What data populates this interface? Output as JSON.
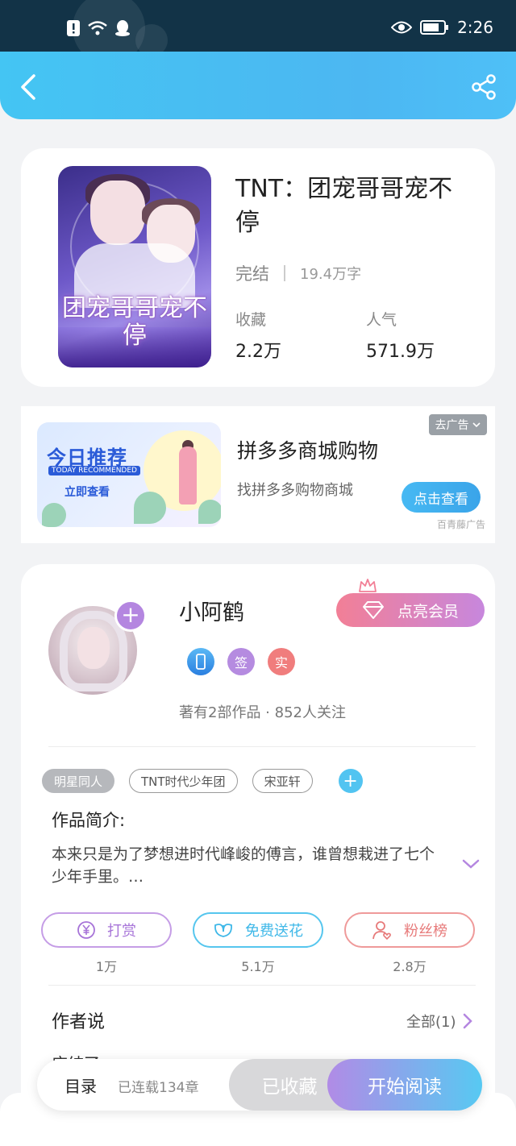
{
  "status_bar": {
    "time": "2:26"
  },
  "book": {
    "title": "TNT：团宠哥哥宠不停",
    "status": "完结",
    "word_count": "19.4万字",
    "favorites_label": "收藏",
    "favorites_value": "2.2万",
    "popularity_label": "人气",
    "popularity_value": "571.9万",
    "cover_title": "团宠哥哥宠不停"
  },
  "ad": {
    "title": "拼多多商城购物",
    "subtitle": "找拼多多购物商城",
    "tag": "去广告",
    "button": "点击查看",
    "source": "百青藤广告",
    "image_headline": "今日推荐",
    "image_en": "TODAY RECOMMENDED",
    "image_cta": "立即查看"
  },
  "author": {
    "name": "小阿鹤",
    "vip_label": "点亮会员",
    "badge_sign": "签",
    "badge_real": "实",
    "meta": "著有2部作品 · 852人关注"
  },
  "tags": [
    "明星同人",
    "TNT时代少年团",
    "宋亚轩"
  ],
  "intro": {
    "title": "作品简介:",
    "text": "本来只是为了梦想进时代峰峻的傅言，谁曾想栽进了七个少年手里。…"
  },
  "actions": [
    {
      "label": "打赏",
      "count": "1万",
      "icon": "yen-icon"
    },
    {
      "label": "免费送花",
      "count": "5.1万",
      "icon": "flower-icon"
    },
    {
      "label": "粉丝榜",
      "count": "2.8万",
      "icon": "user-heart-icon"
    }
  ],
  "author_says": {
    "title": "作者说",
    "all_label": "全部(1)",
    "peek": "应结了"
  },
  "bottom": {
    "toc": "目录",
    "chapters": "已连载134章",
    "collected": "已收藏",
    "read": "开始阅读"
  },
  "colors": {
    "accent": "#4cb7f2",
    "brand_purple": "#b486e0",
    "status_bar": "#123347"
  }
}
